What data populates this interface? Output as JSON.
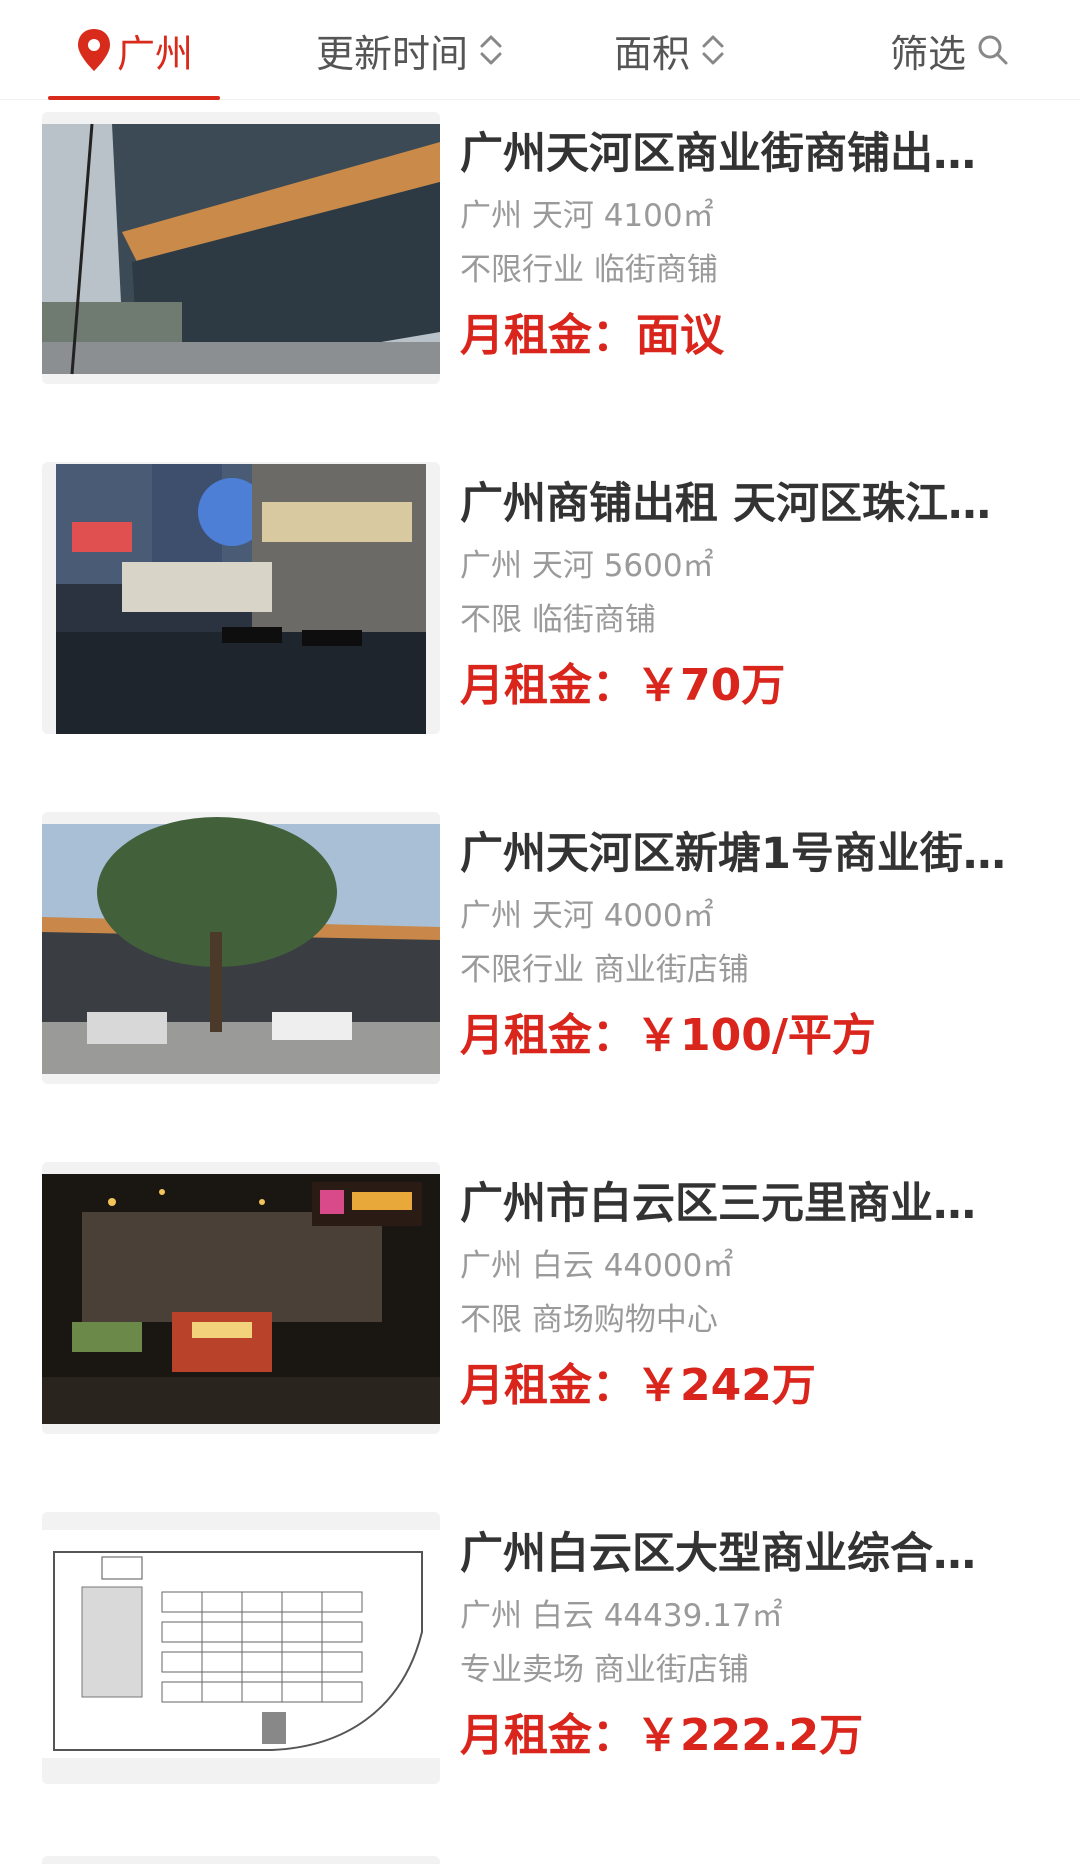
{
  "filter_bar": {
    "city": "广州",
    "sort_time": "更新时间",
    "area": "面积",
    "filter": "筛选"
  },
  "colors": {
    "accent": "#d92b1c",
    "title": "#333333",
    "meta": "#9a9a9a"
  },
  "listings": [
    {
      "title": "广州天河区商业街商铺出…",
      "location": "广州 天河 4100㎡",
      "tags": "不限行业 临街商铺",
      "price_label": "月租金：",
      "price": "面议",
      "image": "street-shopfront-photo"
    },
    {
      "title": "广州商铺出租 天河区珠江…",
      "location": "广州 天河 5600㎡",
      "tags": "不限 临街商铺",
      "price_label": "月租金：",
      "price": "￥70万",
      "image": "night-plaza-photo"
    },
    {
      "title": "广州天河区新塘1号商业街…",
      "location": "广州 天河 4000㎡",
      "tags": "不限行业 商业街店铺",
      "price_label": "月租金：",
      "price": "￥100/平方",
      "image": "commercial-street-photo"
    },
    {
      "title": "广州市白云区三元里商业…",
      "location": "广州 白云 44000㎡",
      "tags": "不限 商场购物中心",
      "price_label": "月租金：",
      "price": "￥242万",
      "image": "night-mall-photo"
    },
    {
      "title": "广州白云区大型商业综合…",
      "location": "广州 白云 44439.17㎡",
      "tags": "专业卖场 商业街店铺",
      "price_label": "月租金：",
      "price": "￥222.2万",
      "image": "floor-plan-drawing"
    }
  ]
}
